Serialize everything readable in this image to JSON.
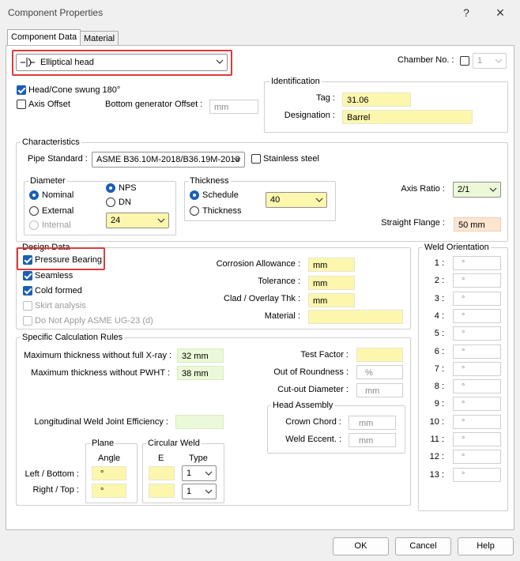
{
  "window": {
    "title": "Component Properties",
    "help_icon": "?",
    "close_icon": "×"
  },
  "tabs": [
    {
      "label": "Component Data"
    },
    {
      "label": "Material"
    }
  ],
  "component": {
    "type_icon": "elliptical-head-icon",
    "type_value": "Elliptical head"
  },
  "chamber": {
    "label": "Chamber No. :",
    "value": "1"
  },
  "options": {
    "head_swung_label": "Head/Cone swung 180°",
    "axis_offset_label": "Axis Offset",
    "bottom_gen_label": "Bottom generator Offset :",
    "bottom_gen_value": "mm"
  },
  "identification": {
    "title": "Identification",
    "tag_label": "Tag :",
    "tag_value": "31.06",
    "designation_label": "Designation :",
    "designation_value": "Barrel"
  },
  "characteristics": {
    "title": "Characteristics",
    "pipe_standard_label": "Pipe Standard :",
    "pipe_standard_value": "ASME B36.10M-2018/B36.19M-2018",
    "stainless_label": "Stainless steel",
    "diameter": {
      "title": "Diameter",
      "nominal": "Nominal",
      "external": "External",
      "internal": "Internal",
      "nps": "NPS",
      "dn": "DN",
      "size_value": "24"
    },
    "thickness": {
      "title": "Thickness",
      "schedule": "Schedule",
      "thickness": "Thickness",
      "schedule_value": "40"
    },
    "axis_ratio_label": "Axis Ratio :",
    "axis_ratio_value": "2/1",
    "straight_flange_label": "Straight Flange :",
    "straight_flange_value": "50 mm"
  },
  "design": {
    "title": "Design Data",
    "pressure_bearing": "Pressure Bearing",
    "seamless": "Seamless",
    "cold_formed": "Cold formed",
    "skirt_analysis": "Skirt analysis",
    "do_not_apply": "Do Not Apply ASME UG-23 (d)",
    "corrosion_label": "Corrosion Allowance :",
    "corrosion_value": "mm",
    "tolerance_label": "Tolerance :",
    "tolerance_value": "mm",
    "clad_label": "Clad / Overlay Thk :",
    "clad_value": "mm",
    "material_label": "Material :",
    "material_value": ""
  },
  "specific": {
    "title": "Specific Calculation Rules",
    "max_xray_label": "Maximum thickness without full X-ray :",
    "max_xray_value": "32 mm",
    "max_pwht_label": "Maximum thickness without PWHT :",
    "max_pwht_value": "38 mm",
    "test_factor_label": "Test Factor :",
    "test_factor_value": "",
    "out_round_label": "Out of Roundness :",
    "out_round_value": "%",
    "cutout_label": "Cut-out Diameter :",
    "cutout_value": "mm",
    "long_weld_label": "Longitudinal Weld Joint Efficiency :",
    "long_weld_value": "",
    "head_assembly": {
      "title": "Head Assembly",
      "crown_label": "Crown Chord :",
      "crown_value": "mm",
      "weld_label": "Weld Eccent. :",
      "weld_value": "mm"
    },
    "plane": {
      "title": "Plane",
      "angle": "Angle",
      "left_label": "Left / Bottom :",
      "right_label": "Right / Top :",
      "left_value": "°",
      "right_value": "°"
    },
    "circ": {
      "title": "Circular Weld",
      "e": "E",
      "type": "Type",
      "left_type": "1",
      "right_type": "1"
    }
  },
  "weld_orientation": {
    "title": "Weld Orientation",
    "rows": [
      {
        "label": "1 :",
        "value": "°"
      },
      {
        "label": "2 :",
        "value": "°"
      },
      {
        "label": "3 :",
        "value": "°"
      },
      {
        "label": "4 :",
        "value": "°"
      },
      {
        "label": "5 :",
        "value": "°"
      },
      {
        "label": "6 :",
        "value": "°"
      },
      {
        "label": "7 :",
        "value": "°"
      },
      {
        "label": "8 :",
        "value": "°"
      },
      {
        "label": "9 :",
        "value": "°"
      },
      {
        "label": "10 :",
        "value": "°"
      },
      {
        "label": "11 :",
        "value": "°"
      },
      {
        "label": "12 :",
        "value": "°"
      },
      {
        "label": "13 :",
        "value": "°"
      }
    ]
  },
  "buttons": {
    "ok": "OK",
    "cancel": "Cancel",
    "help": "Help"
  },
  "colors": {
    "accent": "#1a5fb4",
    "highlight": "#e03a3a",
    "required": "#fdf7ae",
    "computed": "#ebf9d8",
    "flange": "#fde5d2"
  }
}
